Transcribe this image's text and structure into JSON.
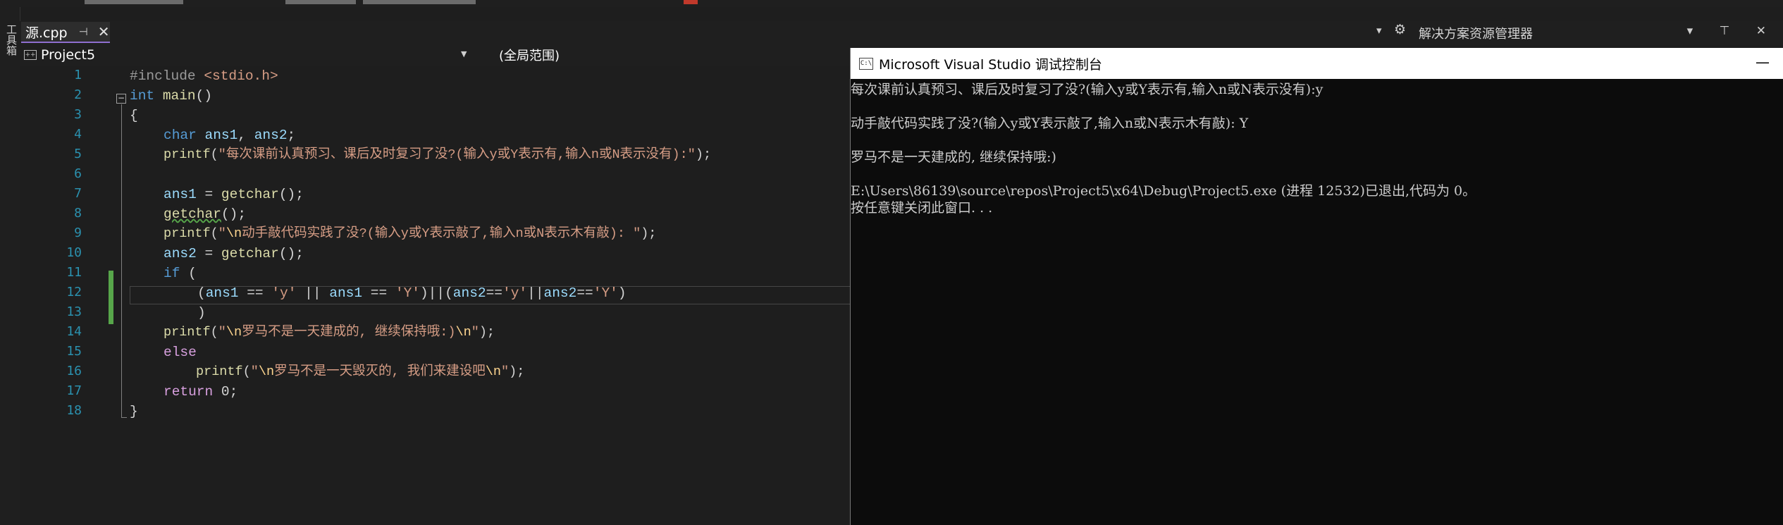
{
  "editor_tab": {
    "title": "源.cpp",
    "pin": "⊣",
    "close": "✕"
  },
  "side_panel_label": "工具箱",
  "solution_explorer": {
    "title": "解决方案资源管理器",
    "buttons": "▾ ⊤ ✕"
  },
  "nav": {
    "project": "Project5",
    "scope": "(全局范围)"
  },
  "line_numbers": [
    "1",
    "2",
    "3",
    "4",
    "5",
    "6",
    "7",
    "8",
    "9",
    "10",
    "11",
    "12",
    "13",
    "14",
    "15",
    "16",
    "17",
    "18"
  ],
  "code": {
    "l1_pre": "#include ",
    "l1_hdr": "<stdio.h>",
    "l2_kw": "int",
    "l2_fn": "main",
    "l2_rest": "()",
    "l3": "{",
    "l4_kw": "char",
    "l4_v1": "ans1",
    "l4_sep": ", ",
    "l4_v2": "ans2",
    "l4_end": ";",
    "l5_fn": "printf",
    "l5_open": "(",
    "l5_str": "\"每次课前认真预习、课后及时复习了没?(输入y或Y表示有,输入n或N表示没有):\"",
    "l5_end": ");",
    "l7_var": "ans1",
    "l7_eq": " = ",
    "l7_fn": "getchar",
    "l7_end": "();",
    "l8_fn": "getchar",
    "l8_end": "();",
    "l9_fn": "printf",
    "l9_open": "(",
    "l9_q": "\"",
    "l9_esc": "\\n",
    "l9_str": "动手敲代码实践了没?(输入y或Y表示敲了,输入n或N表示木有敲): \"",
    "l9_end": ");",
    "l10_var": "ans2",
    "l10_eq": " = ",
    "l10_fn": "getchar",
    "l10_end": "();",
    "l11_kw": "if",
    "l11_rest": " (",
    "l12_p1": "(",
    "l12_v1": "ans1",
    "l12_o1": " == ",
    "l12_s1": "'y'",
    "l12_or1": " || ",
    "l12_v2": "ans1",
    "l12_o2": " == ",
    "l12_s2": "'Y'",
    "l12_p2": ")||(",
    "l12_v3": "ans2",
    "l12_o3": "==",
    "l12_s3": "'y'",
    "l12_or2": "||",
    "l12_v4": "ans2",
    "l12_o4": "==",
    "l12_s4": "'Y'",
    "l12_p3": ")",
    "l13": ")",
    "l14_fn": "printf",
    "l14_open": "(",
    "l14_q": "\"",
    "l14_esc": "\\n",
    "l14_str": "罗马不是一天建成的, 继续保持哦:)",
    "l14_esc2": "\\n",
    "l14_q2": "\"",
    "l14_end": ");",
    "l15_kw": "else",
    "l16_fn": "printf",
    "l16_open": "(",
    "l16_q": "\"",
    "l16_esc": "\\n",
    "l16_str": "罗马不是一天毁灭的, 我们来建设吧",
    "l16_esc2": "\\n",
    "l16_q2": "\"",
    "l16_end": ");",
    "l17_kw": "return",
    "l17_rest": " 0;",
    "l18": "}"
  },
  "console": {
    "title": "Microsoft Visual Studio 调试控制台",
    "icon_text": "C:\\",
    "minimize": "—",
    "lines": [
      "每次课前认真预习、课后及时复习了没?(输入y或Y表示有,输入n或N表示没有):y",
      "动手敲代码实践了没?(输入y或Y表示敲了,输入n或N表示木有敲): Y",
      "罗马不是一天建成的, 继续保持哦:)",
      "E:\\Users\\86139\\source\\repos\\Project5\\x64\\Debug\\Project5.exe (进程 12532)已退出,代码为 0。",
      "按任意键关闭此窗口. . ."
    ]
  }
}
